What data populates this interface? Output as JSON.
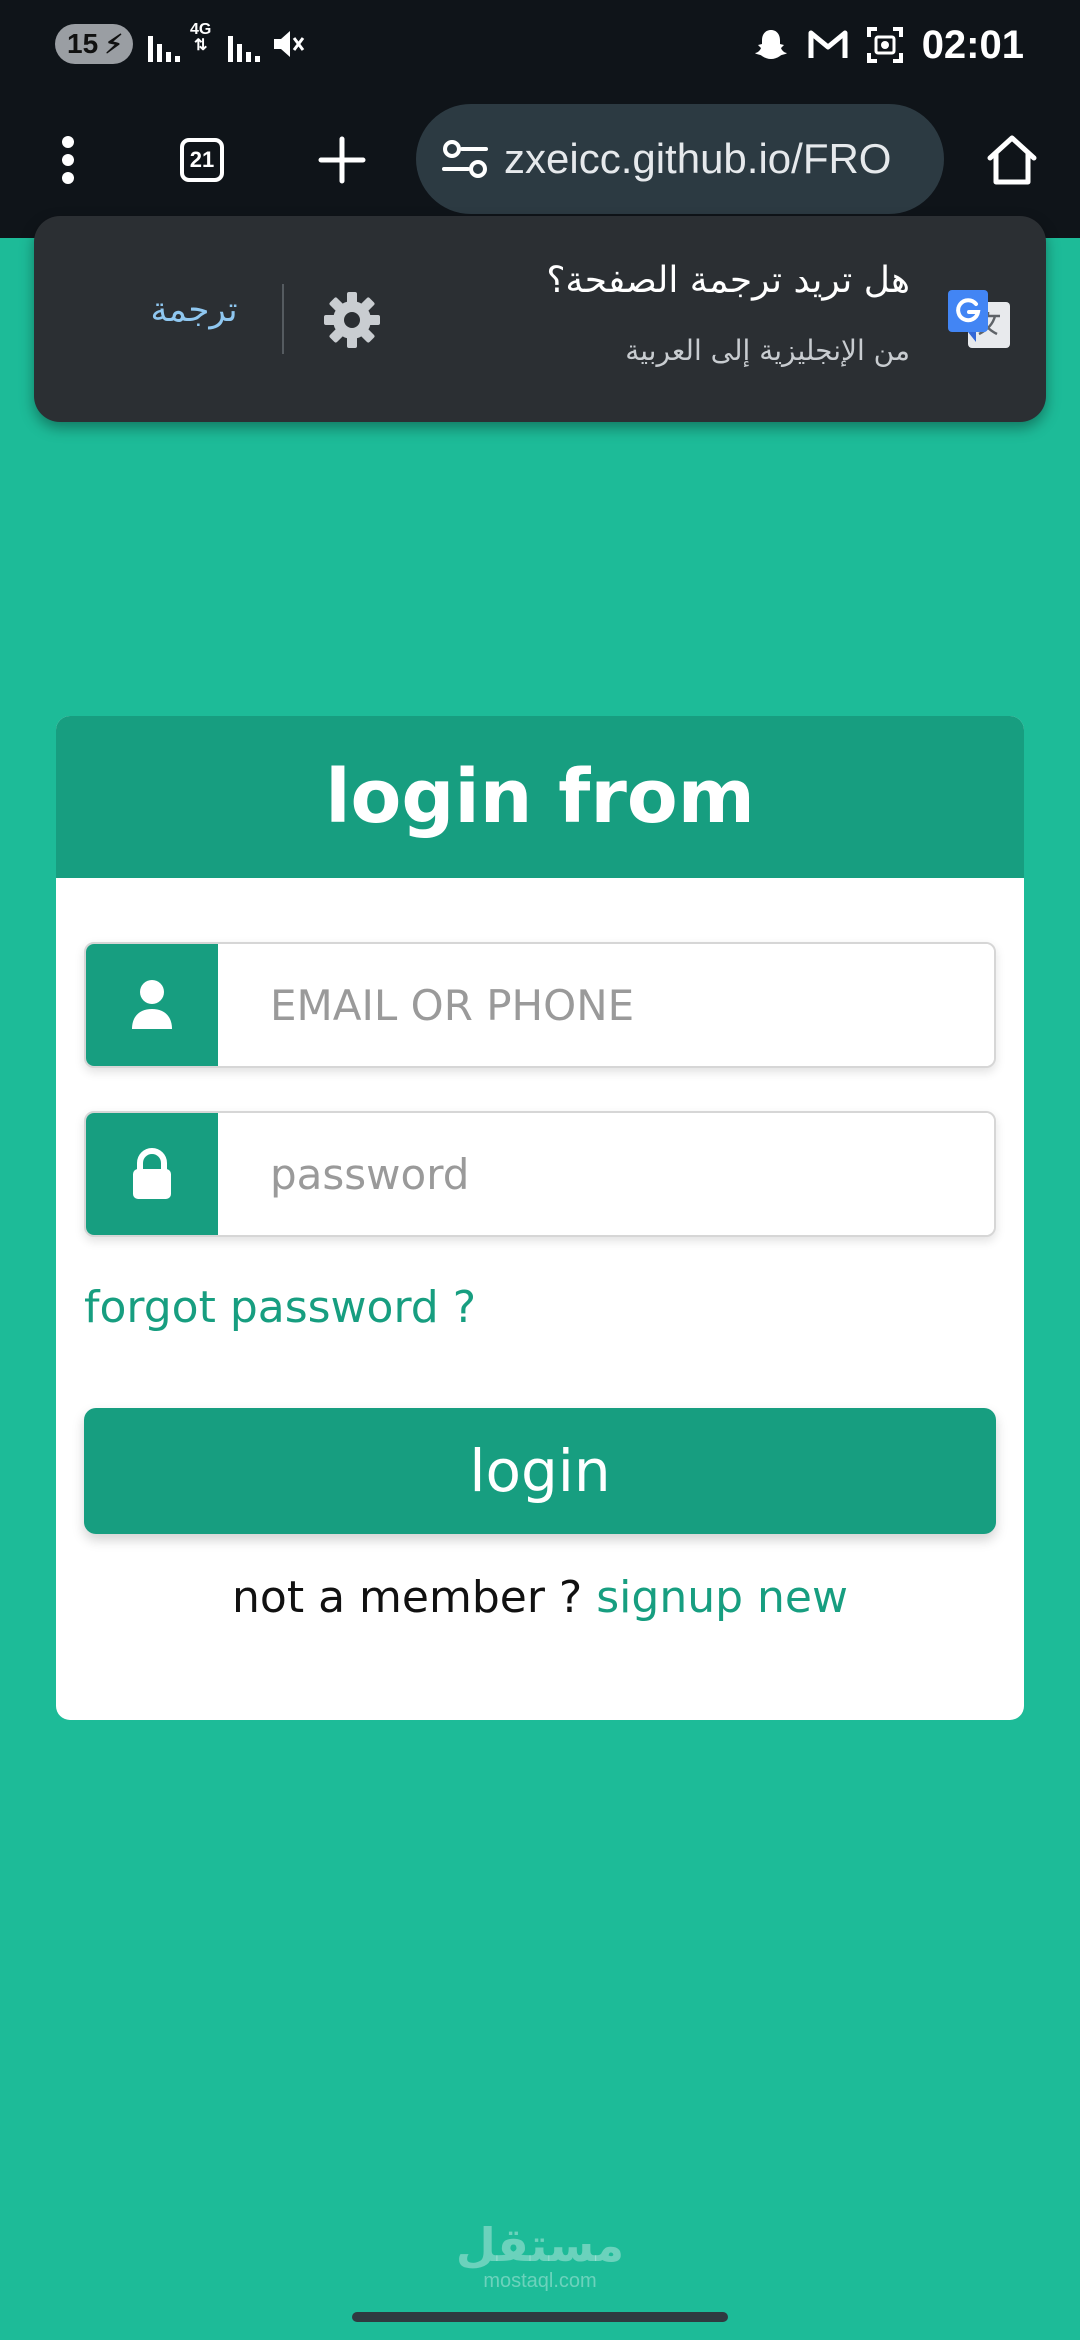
{
  "status_bar": {
    "battery_level": "15",
    "network_type": "4G",
    "time": "02:01"
  },
  "browser": {
    "tabs_count": "21",
    "url": "zxeicc.github.io/FRO",
    "icons": [
      "menu-kebab-icon",
      "tabs-icon",
      "new-tab-plus-icon",
      "site-settings-icon",
      "home-icon"
    ]
  },
  "translate_popup": {
    "action_label": "ترجمة",
    "title": "هل تريد ترجمة الصفحة؟",
    "subtitle": "من الإنجليزية إلى العربية",
    "icons": [
      "settings-gear-icon",
      "google-translate-icon"
    ]
  },
  "login_form": {
    "heading": "login from",
    "email_placeholder": "EMAIL OR PHONE",
    "password_placeholder": "password",
    "forgot_link": "forgot password ?",
    "submit_label": "login",
    "signup_prompt": "not a member ?",
    "signup_link": "signup new",
    "icons": [
      "user-icon",
      "lock-icon"
    ]
  },
  "watermark": {
    "arabic": "مستقل",
    "latin": "mostaql.com"
  },
  "colors": {
    "page_bg": "#1dbb98",
    "accent": "#179e80",
    "toolbar_bg": "#0f1419",
    "popup_bg": "#2b2f33",
    "link_blue": "#8fc7f0"
  }
}
